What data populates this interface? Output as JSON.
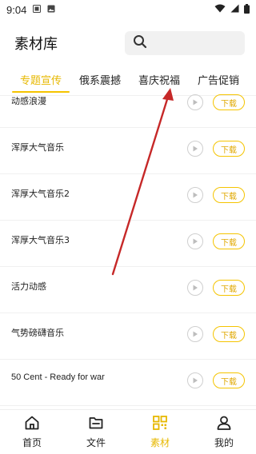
{
  "status_bar": {
    "time": "9:04"
  },
  "header": {
    "title": "素材库",
    "search_icon": "search-icon"
  },
  "tabs": [
    {
      "label": "专题宣传",
      "active": true
    },
    {
      "label": "俄系震撼",
      "active": false
    },
    {
      "label": "喜庆祝福",
      "active": false
    },
    {
      "label": "广告促销",
      "active": false
    }
  ],
  "items": [
    {
      "title": "动感浪漫",
      "download_label": "下载"
    },
    {
      "title": "浑厚大气音乐",
      "download_label": "下载"
    },
    {
      "title": "浑厚大气音乐2",
      "download_label": "下载"
    },
    {
      "title": "浑厚大气音乐3",
      "download_label": "下载"
    },
    {
      "title": "活力动感",
      "download_label": "下载"
    },
    {
      "title": "气势磅礴音乐",
      "download_label": "下载"
    },
    {
      "title": "50 Cent - Ready for war",
      "download_label": "下载"
    }
  ],
  "bottom_nav": [
    {
      "label": "首页",
      "icon": "home-icon",
      "active": false
    },
    {
      "label": "文件",
      "icon": "folder-icon",
      "active": false
    },
    {
      "label": "素材",
      "icon": "qr-grid-icon",
      "active": true
    },
    {
      "label": "我的",
      "icon": "profile-icon",
      "active": false
    }
  ],
  "colors": {
    "accent": "#f5c400",
    "accent_text": "#e0a800",
    "annotation_arrow": "#c62828"
  }
}
